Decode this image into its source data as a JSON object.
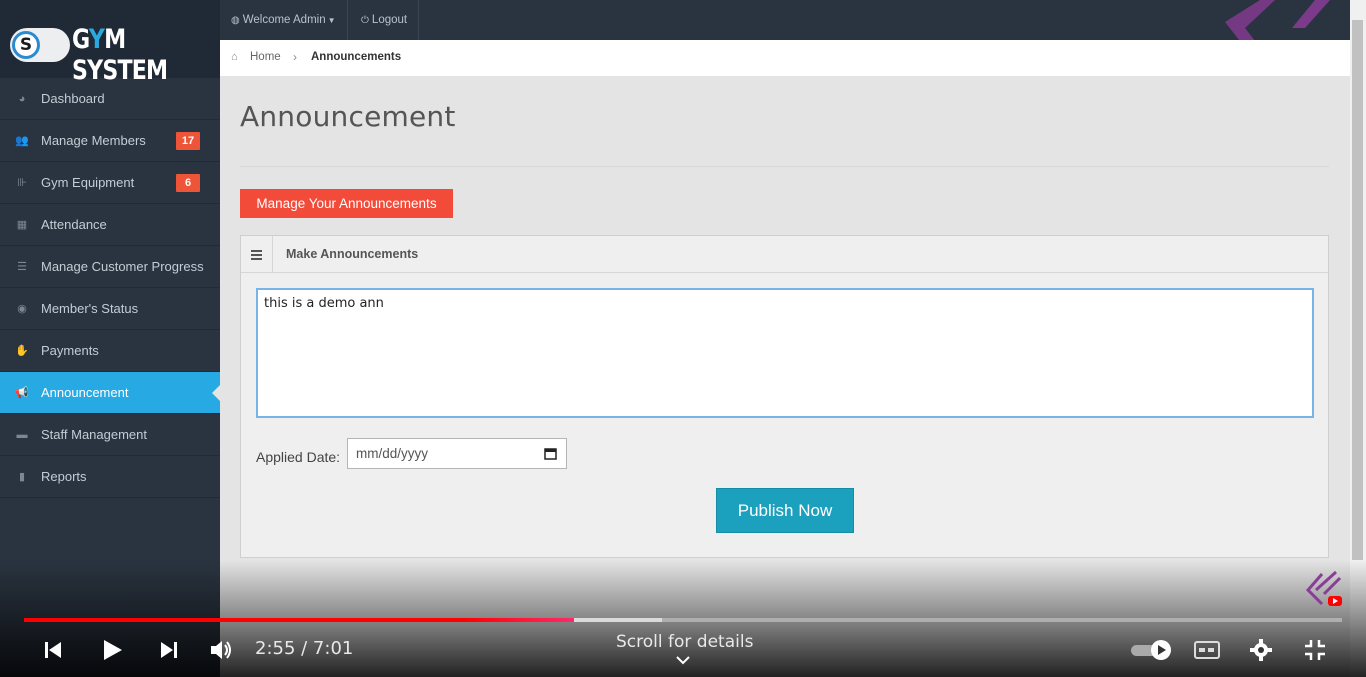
{
  "brand": {
    "title_prefix": "G",
    "title_y": "Y",
    "title_rest": "M SYSTEM",
    "logo_letter": "S"
  },
  "topbar": {
    "welcome": "Welcome Admin",
    "logout": "Logout"
  },
  "sidebar": {
    "items": [
      {
        "label": "Dashboard",
        "icon": "dashboard-icon",
        "glyph": "◕"
      },
      {
        "label": "Manage Members",
        "icon": "users-icon",
        "glyph": "👥",
        "badge": "17"
      },
      {
        "label": "Gym Equipment",
        "icon": "dumbbell-icon",
        "glyph": "⊪",
        "badge": "6"
      },
      {
        "label": "Attendance",
        "icon": "calendar-icon",
        "glyph": "▦"
      },
      {
        "label": "Manage Customer Progress",
        "icon": "tasks-icon",
        "glyph": "☰"
      },
      {
        "label": "Member's Status",
        "icon": "eye-icon",
        "glyph": "◉"
      },
      {
        "label": "Payments",
        "icon": "hand-money-icon",
        "glyph": "✋"
      },
      {
        "label": "Announcement",
        "icon": "megaphone-icon",
        "glyph": "📢",
        "active": true
      },
      {
        "label": "Staff Management",
        "icon": "briefcase-icon",
        "glyph": "▬"
      },
      {
        "label": "Reports",
        "icon": "file-icon",
        "glyph": "▮"
      }
    ]
  },
  "breadcrumb": {
    "home": "Home",
    "current": "Announcements"
  },
  "main": {
    "title": "Announcement",
    "manage_button": "Manage Your Announcements",
    "box_title": "Make Announcements",
    "announcement_text": "this is a demo ann",
    "date_label": "Applied Date:",
    "date_placeholder": "mm/dd/yyyy",
    "publish_button": "Publish Now"
  },
  "player": {
    "time": "2:55 / 7:01",
    "scroll_hint": "Scroll for details",
    "played_fraction": 0.417,
    "buffered_fraction": 0.484
  },
  "colors": {
    "accent": "#27a9e3",
    "danger": "#f34b39",
    "publish": "#1ba0be",
    "sidebar": "#2a3440",
    "progress": "#ff0000"
  }
}
